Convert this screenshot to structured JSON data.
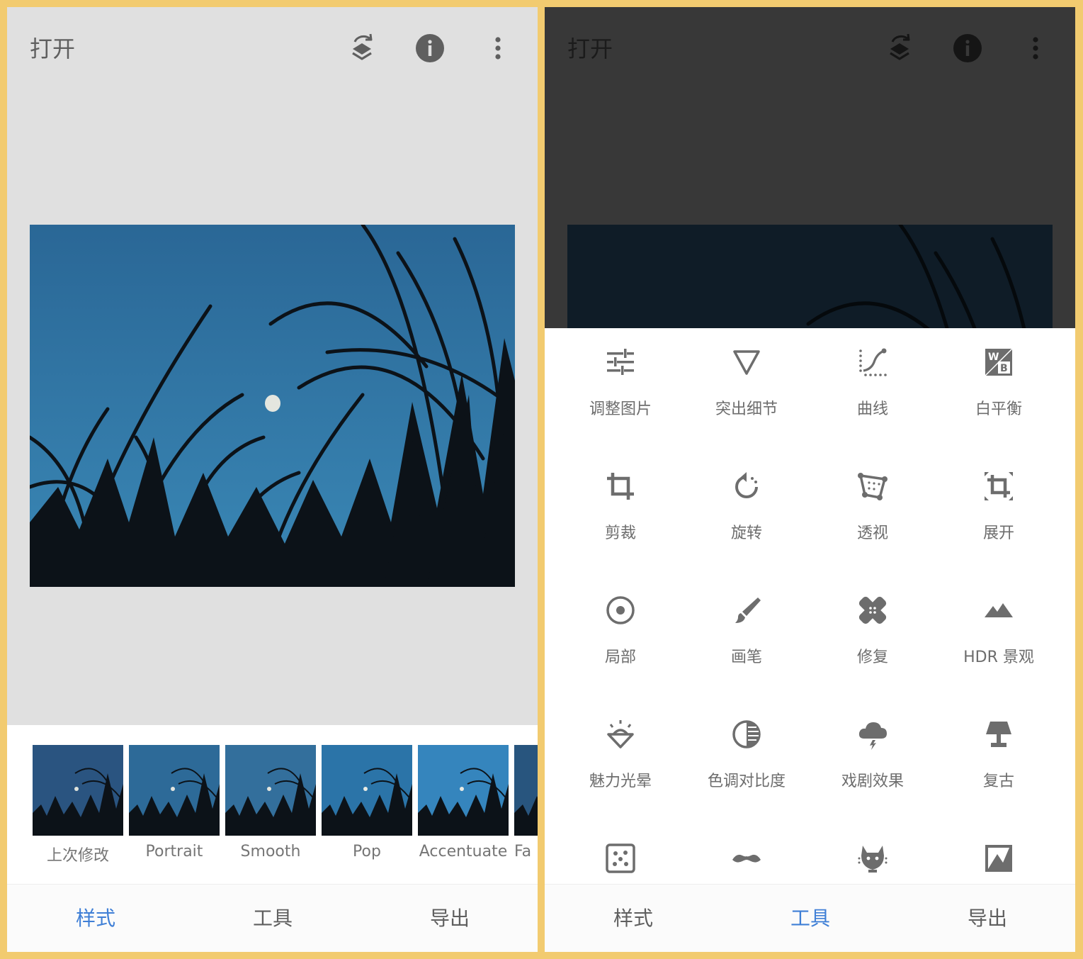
{
  "left_screen": {
    "title": "打开",
    "icons": [
      "layers-undo-icon",
      "info-icon",
      "more-vert-icon"
    ],
    "looks": [
      {
        "label": "上次修改"
      },
      {
        "label": "Portrait"
      },
      {
        "label": "Smooth"
      },
      {
        "label": "Pop"
      },
      {
        "label": "Accentuate"
      },
      {
        "label": "Fa"
      }
    ],
    "nav": {
      "styles": "样式",
      "tools": "工具",
      "export": "导出",
      "active": "styles"
    }
  },
  "right_screen": {
    "title": "打开",
    "icons": [
      "layers-undo-icon",
      "info-icon",
      "more-vert-icon"
    ],
    "tools": [
      {
        "label": "调整图片",
        "icon": "tune-icon"
      },
      {
        "label": "突出细节",
        "icon": "details-icon"
      },
      {
        "label": "曲线",
        "icon": "curves-icon"
      },
      {
        "label": "白平衡",
        "icon": "white-balance-icon"
      },
      {
        "label": "剪裁",
        "icon": "crop-icon"
      },
      {
        "label": "旋转",
        "icon": "rotate-icon"
      },
      {
        "label": "透视",
        "icon": "perspective-icon"
      },
      {
        "label": "展开",
        "icon": "expand-icon"
      },
      {
        "label": "局部",
        "icon": "selective-icon"
      },
      {
        "label": "画笔",
        "icon": "brush-icon"
      },
      {
        "label": "修复",
        "icon": "healing-icon"
      },
      {
        "label": "HDR 景观",
        "icon": "hdr-scape-icon"
      },
      {
        "label": "魅力光晕",
        "icon": "glamour-glow-icon"
      },
      {
        "label": "色调对比度",
        "icon": "tonal-contrast-icon"
      },
      {
        "label": "戏剧效果",
        "icon": "drama-icon"
      },
      {
        "label": "复古",
        "icon": "vintage-icon"
      },
      {
        "label": "",
        "icon": "grainy-film-icon"
      },
      {
        "label": "",
        "icon": "retrolux-icon"
      },
      {
        "label": "",
        "icon": "grunge-icon"
      },
      {
        "label": "",
        "icon": "black-white-icon"
      }
    ],
    "nav": {
      "styles": "样式",
      "tools": "工具",
      "export": "导出",
      "active": "tools"
    }
  },
  "colors": {
    "accent": "#3f7fd6",
    "frame": "#f2cb70",
    "icon_gray": "#6d6d6d"
  }
}
